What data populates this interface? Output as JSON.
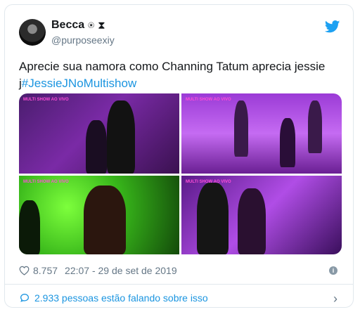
{
  "tweet": {
    "display_name": "Becca",
    "name_icons": [
      "⍟",
      "⧗"
    ],
    "handle": "@purposeexiy",
    "text_plain": "Aprecie sua namora como Channing Tatum aprecia jessie j",
    "hashtag": "#JessieJNoMultishow",
    "likes": "8.757",
    "timestamp": "22:07 - 29 de set de 2019",
    "talking": "2.933 pessoas estão falando sobre isso"
  },
  "media": {
    "logo_text": "MULTI SHOW AO VIVO"
  },
  "colors": {
    "link": "#1b95e0",
    "secondary": "#657786",
    "border": "#e1e8ed"
  }
}
